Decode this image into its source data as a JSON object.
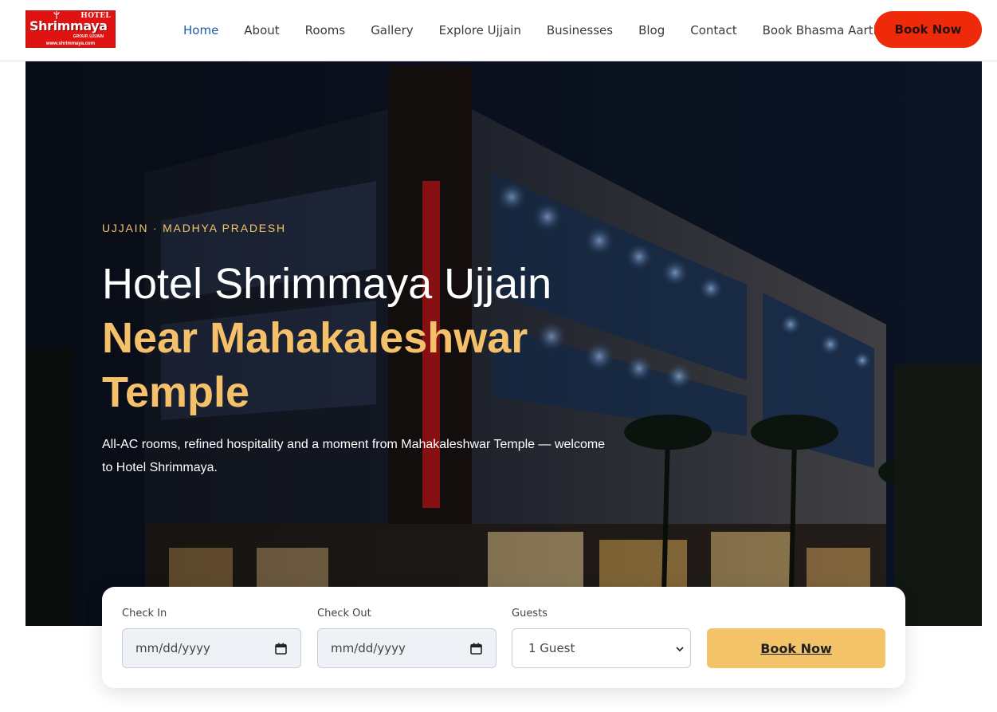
{
  "header": {
    "logo": {
      "hotel": "HOTEL",
      "name": "Shrimmaya",
      "group": "GROUP, UJJAIN",
      "url": "www.shrimmaya.com"
    },
    "nav": [
      {
        "label": "Home",
        "active": true
      },
      {
        "label": "About",
        "active": false
      },
      {
        "label": "Rooms",
        "active": false
      },
      {
        "label": "Gallery",
        "active": false
      },
      {
        "label": "Explore Ujjain",
        "active": false
      },
      {
        "label": "Businesses",
        "active": false
      },
      {
        "label": "Blog",
        "active": false
      },
      {
        "label": "Contact",
        "active": false
      },
      {
        "label": "Book Bhasma Aarti",
        "active": false
      }
    ],
    "book_now": "Book Now"
  },
  "hero": {
    "eyebrow": "UJJAIN · MADHYA PRADESH",
    "title_line1": "Hotel Shrimmaya Ujjain",
    "title_accent": "Near Mahakaleshwar Temple",
    "subtitle": "All-AC rooms, refined hospitality and a moment from Mahakaleshwar Temple — welcome to Hotel Shrimmaya."
  },
  "booking": {
    "check_in": {
      "label": "Check In",
      "placeholder": "mm/dd/yyyy"
    },
    "check_out": {
      "label": "Check Out",
      "placeholder": "mm/dd/yyyy"
    },
    "guests": {
      "label": "Guests",
      "selected": "1 Guest"
    },
    "submit": "Book Now"
  },
  "colors": {
    "brand_red": "#ee2a0a",
    "accent_gold": "#f5c06a",
    "nav_active": "#1e5aa8"
  },
  "icons": [
    "calendar-icon",
    "chevron-down-icon"
  ]
}
